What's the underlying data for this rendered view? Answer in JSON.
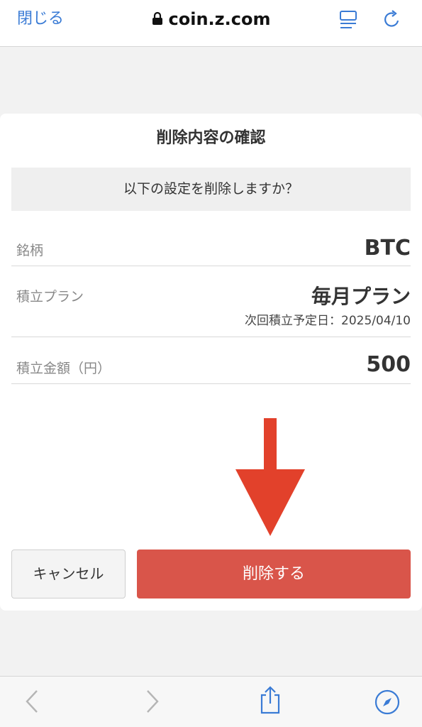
{
  "browser": {
    "close_label": "閉じる",
    "url": "coin.z.com"
  },
  "dialog": {
    "title": "削除内容の確認",
    "question": "以下の設定を削除しますか？",
    "rows": [
      {
        "label": "銘柄",
        "value": "BTC"
      },
      {
        "label": "積立プラン",
        "value": "毎月プラン",
        "sub": "次回積立予定日：2025/04/10"
      },
      {
        "label": "積立金額（円）",
        "value": "500"
      }
    ],
    "cancel_label": "キャンセル",
    "delete_label": "削除する"
  },
  "colors": {
    "link_blue": "#3a7bd5",
    "delete_red": "#d9554a",
    "arrow_red": "#e2412b"
  },
  "icons": {
    "top": [
      "lock-icon",
      "reader-icon",
      "reload-icon"
    ],
    "bottom": [
      "back-icon",
      "forward-icon",
      "share-icon",
      "compass-icon"
    ]
  }
}
